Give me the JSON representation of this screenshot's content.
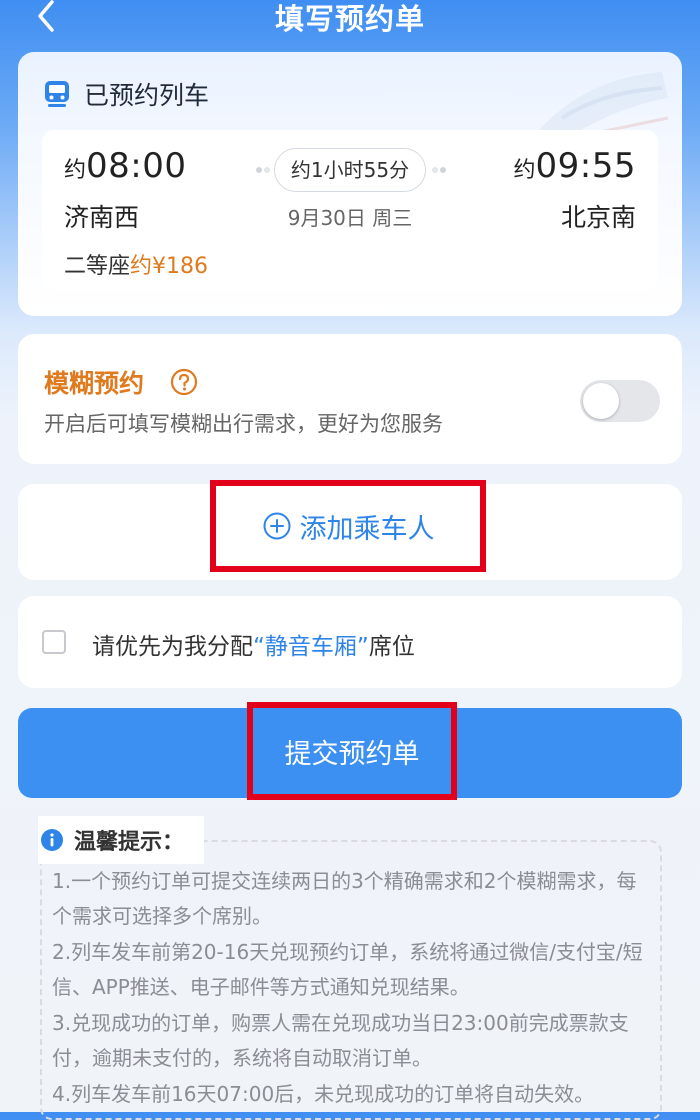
{
  "nav": {
    "title": "填写预约单"
  },
  "train": {
    "header": "已预约列车",
    "approx_prefix": "约",
    "dep_time": "08:00",
    "arr_time": "09:55",
    "dep_station": "济南西",
    "arr_station": "北京南",
    "duration": "约1小时55分",
    "date": "9月30日 周三",
    "seat_class": "二等座",
    "price": "约¥186"
  },
  "fuzzy": {
    "title": "模糊预约",
    "description": "开启后可填写模糊出行需求，更好为您服务",
    "enabled": false
  },
  "add_passenger": {
    "label": "添加乘车人"
  },
  "quiet_car": {
    "prefix": "请优先为我分配",
    "highlight": "“静音车厢”",
    "suffix": "席位",
    "checked": false
  },
  "submit": {
    "label": "提交预约单"
  },
  "tips": {
    "title": "温馨提示：",
    "items": [
      "1.一个预约订单可提交连续两日的3个精确需求和2个模糊需求，每个需求可选择多个席别。",
      "2.列车发车前第20-16天兑现预约订单，系统将通过微信/支付宝/短信、APP推送、电子邮件等方式通知兑现结果。",
      "3.兑现成功的订单，购票人需在兑现成功当日23:00前完成票款支付，逾期未支付的，系统将自动取消订单。",
      "4.列车发车前16天07:00后，未兑现成功的订单将自动失效。"
    ]
  },
  "colors": {
    "primary": "#3b90f2",
    "accent_orange": "#e07a1f",
    "highlight_red": "#e3001b"
  }
}
